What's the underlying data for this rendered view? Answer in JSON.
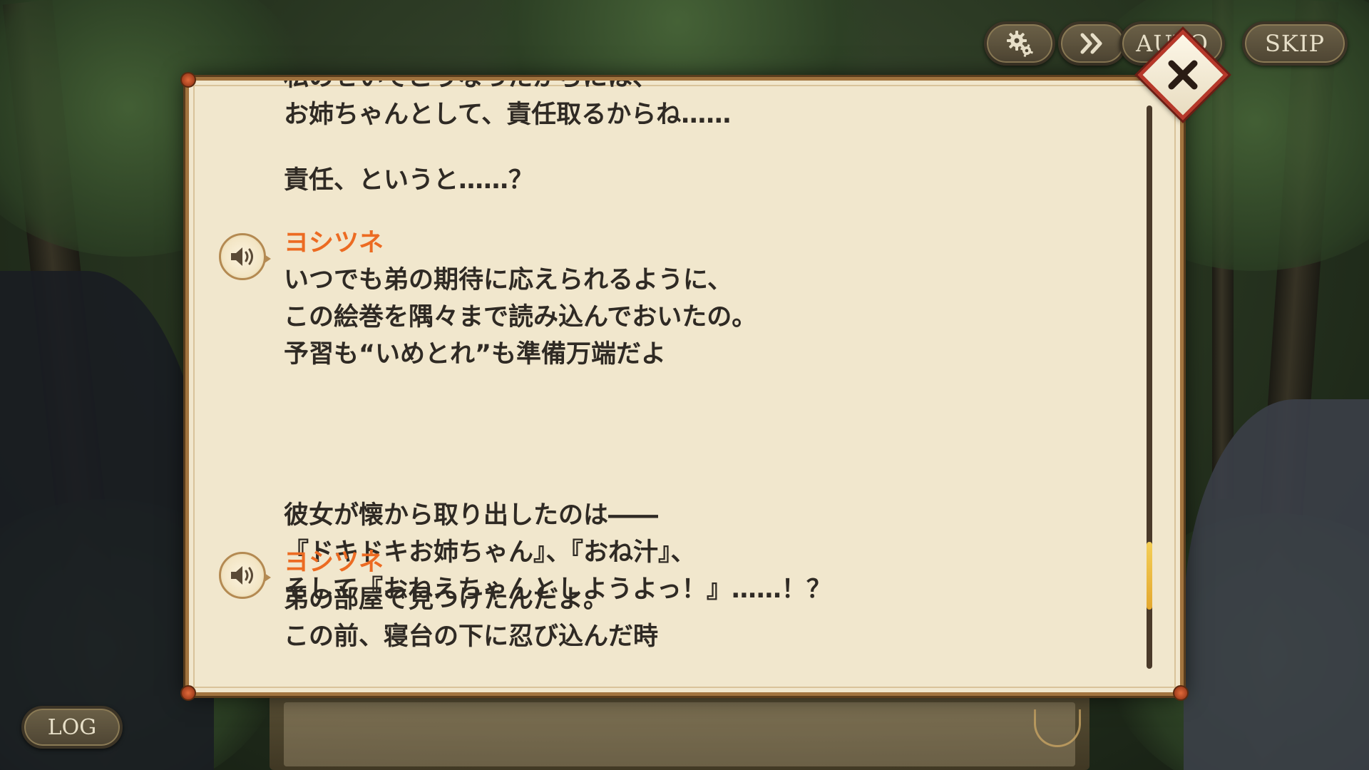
{
  "controls": {
    "settings_icon": "gear-icon",
    "fast_forward_icon": "double-chevron-right-icon",
    "auto_label": "AUTO",
    "skip_label": "SKIP",
    "log_label": "LOG"
  },
  "log": {
    "entries": [
      {
        "speaker": "",
        "has_voice": false,
        "lines": [
          "私のせいでこうなったからには、",
          "お姉ちゃんとして、責任取るからね……"
        ]
      },
      {
        "speaker": "",
        "has_voice": false,
        "lines": [
          "責任、というと……？"
        ]
      },
      {
        "speaker": "ヨシツネ",
        "has_voice": true,
        "lines": [
          "いつでも弟の期待に応えられるように、",
          "この絵巻を隅々まで読み込んでおいたの。",
          "予習も“いめとれ”も準備万端だよ"
        ]
      },
      {
        "speaker": "",
        "has_voice": false,
        "lines": [
          "彼女が懐から取り出したのは――",
          "『ドキドキお姉ちゃん』、『おね汁』、",
          "そして『おねえちゃんとしようよっ！』……！？"
        ]
      },
      {
        "speaker": "ヨシツネ",
        "has_voice": true,
        "lines": [
          "弟の部屋で見つけたんだよ。",
          "この前、寝台の下に忍び込んだ時"
        ]
      }
    ],
    "voice_icon": "speaker-icon",
    "close_icon": "close-icon",
    "scroll_position": 0.88,
    "scroll_visible_fraction": 0.12
  },
  "colors": {
    "speaker_name": "#ec6b22",
    "dialogue_text": "#2f2a24",
    "panel_bg": "#f1e7cd",
    "panel_border": "#a2743f",
    "close_border": "#b7382a",
    "scroll_thumb": "#f4cf57"
  }
}
